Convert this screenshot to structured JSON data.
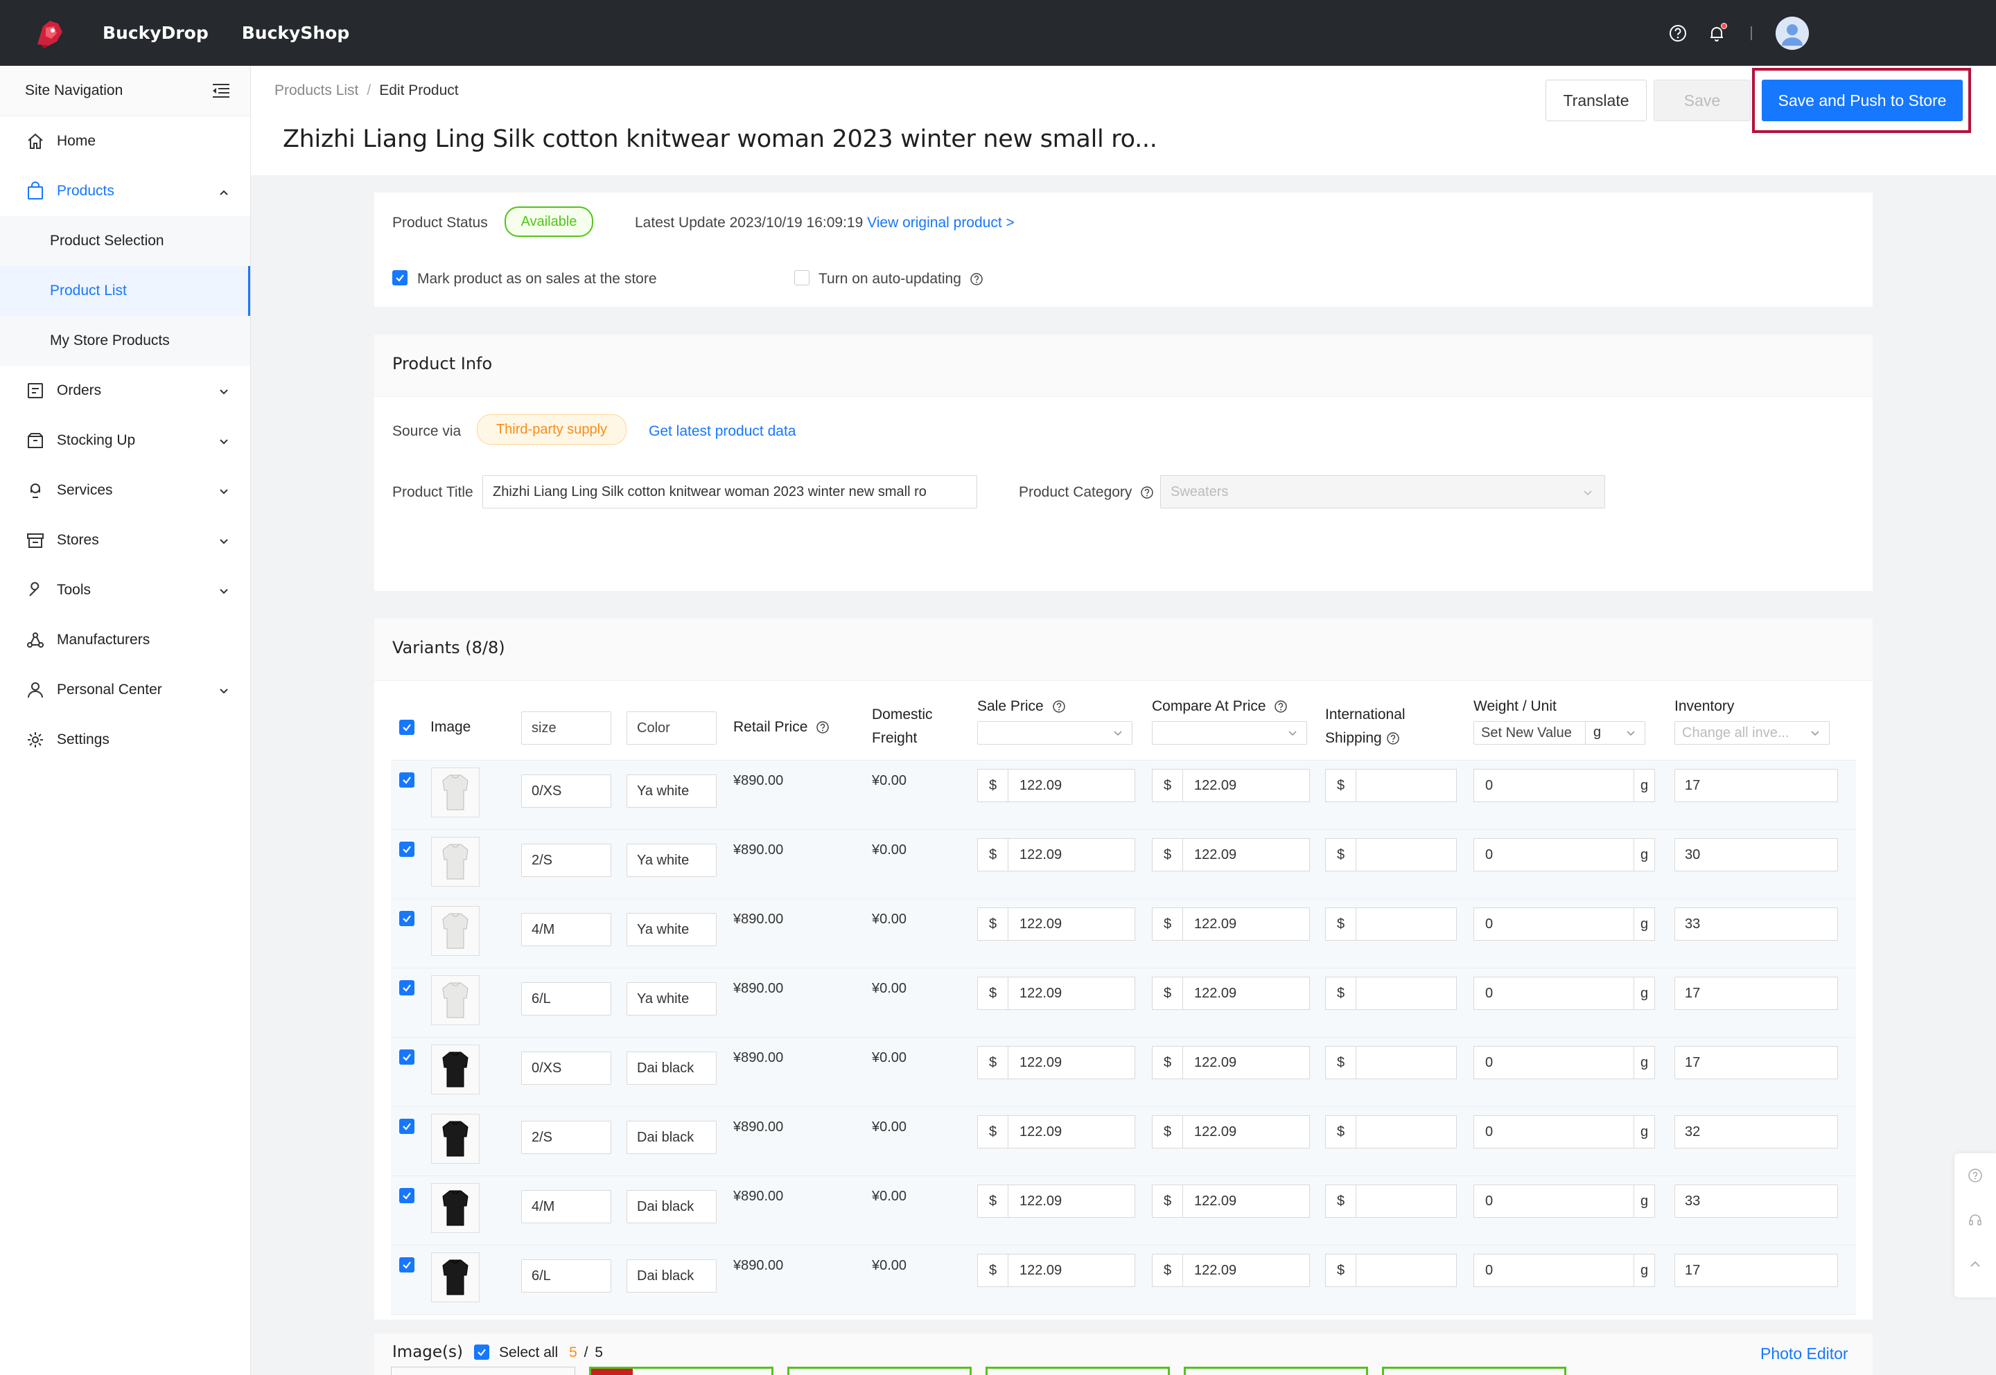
{
  "topbar": {
    "brand1": "BuckyDrop",
    "brand2": "BuckyShop",
    "icons": [
      "help-icon",
      "bell-icon",
      "avatar"
    ]
  },
  "sidebar": {
    "header": "Site Navigation",
    "items": [
      {
        "label": "Home",
        "icon": "home-icon"
      },
      {
        "label": "Products",
        "icon": "bag-icon",
        "expanded": true,
        "children": [
          {
            "label": "Product Selection"
          },
          {
            "label": "Product List",
            "active": true
          },
          {
            "label": "My Store Products"
          }
        ]
      },
      {
        "label": "Orders",
        "icon": "orders-icon"
      },
      {
        "label": "Stocking Up",
        "icon": "box-icon"
      },
      {
        "label": "Services",
        "icon": "services-icon"
      },
      {
        "label": "Stores",
        "icon": "store-icon"
      },
      {
        "label": "Tools",
        "icon": "wrench-icon"
      },
      {
        "label": "Manufacturers",
        "icon": "network-icon"
      },
      {
        "label": "Personal Center",
        "icon": "user-icon"
      },
      {
        "label": "Settings",
        "icon": "gear-icon"
      }
    ]
  },
  "header": {
    "breadcrumb_root": "Products List",
    "breadcrumb_current": "Edit Product",
    "title": "Zhizhi Liang Ling Silk cotton knitwear woman 2023 winter new small ro...",
    "translate": "Translate",
    "save": "Save",
    "push": "Save and Push to Store"
  },
  "status": {
    "label": "Product Status",
    "value": "Available",
    "latest_label": "Latest Update 2023/10/19 16:09:19",
    "view_link": "View original product >",
    "mark_on_sale": "Mark product as on sales at the store",
    "auto_update": "Turn on auto-updating"
  },
  "info": {
    "title": "Product Info",
    "source_label": "Source via",
    "source_value": "Third-party supply",
    "latest_link": "Get latest product data",
    "product_title_label": "Product Title",
    "product_title_value": "Zhizhi Liang Ling Silk cotton knitwear woman 2023 winter new small ro",
    "category_label": "Product Category",
    "category_value": "Sweaters"
  },
  "variants": {
    "title": "Variants (8/8)",
    "headers": {
      "image": "Image",
      "size": "size",
      "color": "Color",
      "retail": "Retail Price",
      "domestic1": "Domestic",
      "domestic2": "Freight",
      "sale": "Sale Price",
      "compare": "Compare At Price",
      "intl1": "International",
      "intl2": "Shipping",
      "weight": "Weight / Unit",
      "weight_placeholder": "Set New Value",
      "weight_unit": "g",
      "inventory": "Inventory",
      "inventory_placeholder": "Change all inve..."
    },
    "rows": [
      {
        "size": "0/XS",
        "color": "Ya white",
        "retail": "¥890.00",
        "domestic": "¥0.00",
        "sale": "122.09",
        "compare": "122.09",
        "weight": "0",
        "unit": "g",
        "inventory": "17",
        "shade": "white"
      },
      {
        "size": "2/S",
        "color": "Ya white",
        "retail": "¥890.00",
        "domestic": "¥0.00",
        "sale": "122.09",
        "compare": "122.09",
        "weight": "0",
        "unit": "g",
        "inventory": "30",
        "shade": "white"
      },
      {
        "size": "4/M",
        "color": "Ya white",
        "retail": "¥890.00",
        "domestic": "¥0.00",
        "sale": "122.09",
        "compare": "122.09",
        "weight": "0",
        "unit": "g",
        "inventory": "33",
        "shade": "white"
      },
      {
        "size": "6/L",
        "color": "Ya white",
        "retail": "¥890.00",
        "domestic": "¥0.00",
        "sale": "122.09",
        "compare": "122.09",
        "weight": "0",
        "unit": "g",
        "inventory": "17",
        "shade": "white"
      },
      {
        "size": "0/XS",
        "color": "Dai black",
        "retail": "¥890.00",
        "domestic": "¥0.00",
        "sale": "122.09",
        "compare": "122.09",
        "weight": "0",
        "unit": "g",
        "inventory": "17",
        "shade": "black"
      },
      {
        "size": "2/S",
        "color": "Dai black",
        "retail": "¥890.00",
        "domestic": "¥0.00",
        "sale": "122.09",
        "compare": "122.09",
        "weight": "0",
        "unit": "g",
        "inventory": "32",
        "shade": "black"
      },
      {
        "size": "4/M",
        "color": "Dai black",
        "retail": "¥890.00",
        "domestic": "¥0.00",
        "sale": "122.09",
        "compare": "122.09",
        "weight": "0",
        "unit": "g",
        "inventory": "33",
        "shade": "black"
      },
      {
        "size": "6/L",
        "color": "Dai black",
        "retail": "¥890.00",
        "domestic": "¥0.00",
        "sale": "122.09",
        "compare": "122.09",
        "weight": "0",
        "unit": "g",
        "inventory": "17",
        "shade": "black"
      }
    ],
    "currency": "$"
  },
  "images": {
    "title": "Image(s)",
    "select_all": "Select all",
    "selected": "5",
    "sep": "/",
    "total": "5",
    "photo_editor": "Photo Editor"
  },
  "colors": {
    "accent": "#1677ff",
    "highlight": "#b4123b",
    "available": "#52c41a",
    "orange": "#fa8c16"
  }
}
